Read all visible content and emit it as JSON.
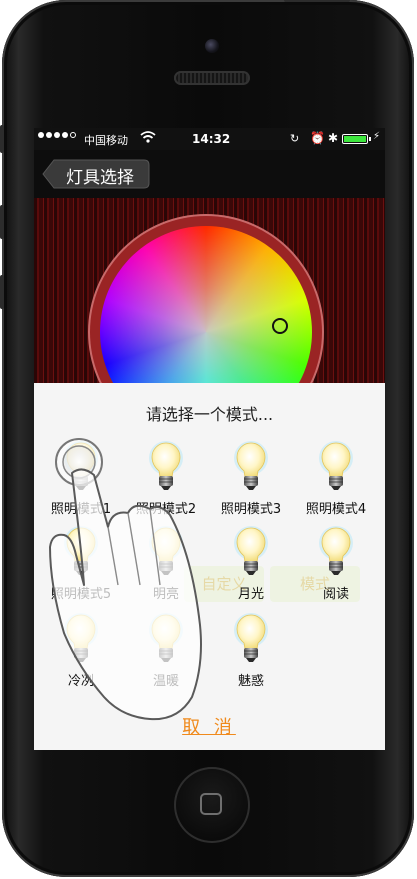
{
  "status_bar": {
    "carrier": "中国移动",
    "time": "14:32"
  },
  "nav": {
    "back_label": "灯具选择"
  },
  "dialog": {
    "title": "请选择一个模式...",
    "modes": [
      {
        "label": "照明模式1"
      },
      {
        "label": "照明模式2"
      },
      {
        "label": "照明模式3"
      },
      {
        "label": "照明模式4"
      },
      {
        "label": "照明模式5"
      },
      {
        "label": "明亮"
      },
      {
        "label": "月光"
      },
      {
        "label": "阅读"
      },
      {
        "label": "冷冽"
      },
      {
        "label": "温暖"
      },
      {
        "label": "魅惑"
      }
    ],
    "cancel_label": "取 消"
  },
  "background_buttons": {
    "left": "自定义",
    "right": "模式"
  },
  "colors": {
    "accent": "#f08a1c",
    "battery": "#3ee63e",
    "curtain": "#5a0b0b"
  },
  "icons": [
    "wifi-icon",
    "rotation-lock-icon",
    "alarm-icon",
    "bluetooth-icon",
    "battery-icon",
    "lightbulb-icon",
    "hand-gesture-icon"
  ]
}
